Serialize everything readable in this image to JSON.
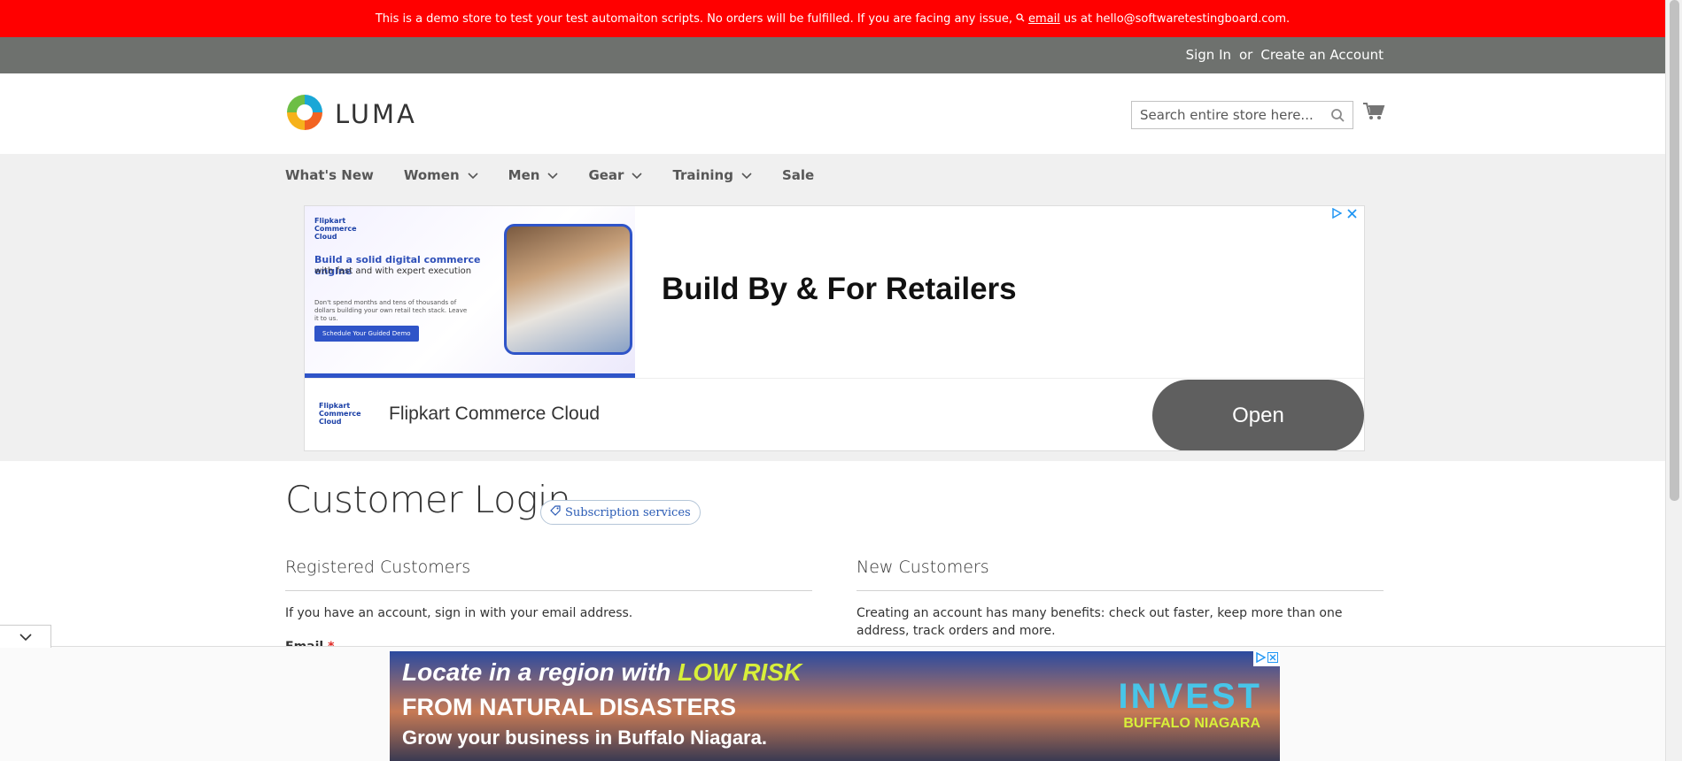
{
  "demo_notice": {
    "text_before": "This is a demo store to test your test automaiton scripts. No orders will be fulfilled. If you are facing any issue,",
    "email_link": "email",
    "text_after": "us at hello@softwaretestingboard.com."
  },
  "panel": {
    "sign_in": "Sign In",
    "or": "or",
    "create_account": "Create an Account"
  },
  "header": {
    "logo_text": "LUMA",
    "search_placeholder": "Search entire store here..."
  },
  "nav": {
    "items": [
      {
        "label": "What's New",
        "has_menu": false
      },
      {
        "label": "Women",
        "has_menu": true
      },
      {
        "label": "Men",
        "has_menu": true
      },
      {
        "label": "Gear",
        "has_menu": true
      },
      {
        "label": "Training",
        "has_menu": true
      },
      {
        "label": "Sale",
        "has_menu": false
      }
    ]
  },
  "ad_top": {
    "image_logo": "Flipkart Commerce Cloud",
    "image_headline": "Build a solid digital commerce engine",
    "image_sub": "with fast and with expert execution",
    "image_small": "Don't spend months and tens of thousands of dollars building your own retail tech stack. Leave it to us.",
    "image_cta": "Schedule Your Guided Demo",
    "title": "Build By & For Retailers",
    "brand_icon": "Flipkart Commerce Cloud",
    "brand": "Flipkart Commerce Cloud",
    "open_button": "Open"
  },
  "page": {
    "title": "Customer Login",
    "badge": "Subscription services"
  },
  "registered": {
    "title": "Registered Customers",
    "text": "If you have an account, sign in with your email address.",
    "email_label": "Email",
    "required_mark": "*"
  },
  "new_customers": {
    "title": "New Customers",
    "text": "Creating an account has many benefits: check out faster, keep more than one address, track orders and more."
  },
  "ad_bottom": {
    "line1_a": "Locate in a region with",
    "line1_b": "LOW RISK",
    "line2": "FROM NATURAL DISASTERS",
    "line3": "Grow your business in Buffalo Niagara.",
    "invest": "INVEST",
    "invest_sub": "BUFFALO NIAGARA"
  },
  "colors": {
    "demo_bar": "#ff0000",
    "panel_bar": "#6e716e",
    "nav_bg": "#f0f0f0",
    "open_button": "#5f5f5f"
  },
  "icons": [
    "search-icon",
    "cart-icon",
    "chevron-down-icon",
    "tag-icon",
    "adchoices-icon",
    "close-icon"
  ]
}
